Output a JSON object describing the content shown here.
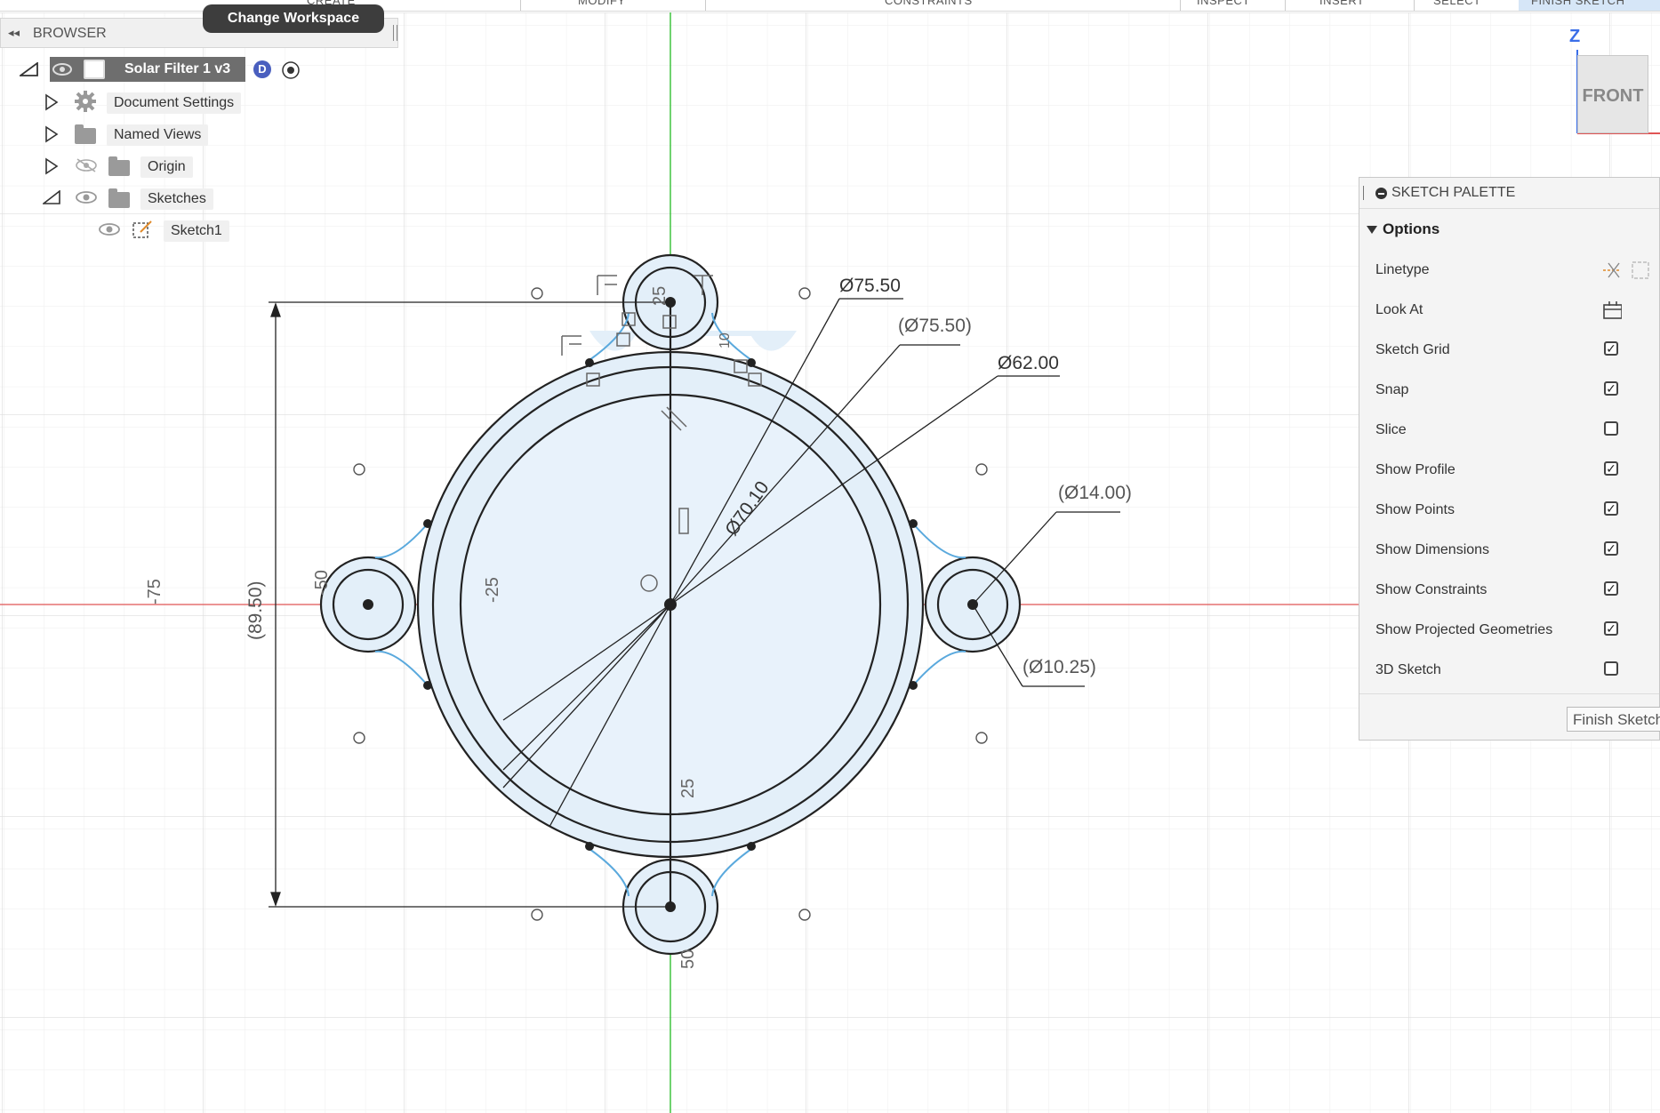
{
  "toolbar": {
    "labels": [
      "CREATE",
      "MODIFY",
      "CONSTRAINTS",
      "INSPECT",
      "INSERT",
      "SELECT",
      "FINISH SKETCH"
    ]
  },
  "tooltip": "Change Workspace",
  "browser": {
    "title": "BROWSER",
    "root": "Solar Filter 1 v3",
    "items": [
      {
        "label": "Document Settings"
      },
      {
        "label": "Named Views"
      },
      {
        "label": "Origin"
      },
      {
        "label": "Sketches"
      },
      {
        "label": "Sketch1"
      }
    ]
  },
  "viewcube": {
    "face": "FRONT",
    "axis": "Z"
  },
  "palette": {
    "title": "SKETCH PALETTE",
    "section": "Options",
    "rows": [
      {
        "label": "Linetype",
        "kind": "icons"
      },
      {
        "label": "Look At",
        "kind": "icon"
      },
      {
        "label": "Sketch Grid",
        "checked": true
      },
      {
        "label": "Snap",
        "checked": true
      },
      {
        "label": "Slice",
        "checked": false
      },
      {
        "label": "Show Profile",
        "checked": true
      },
      {
        "label": "Show Points",
        "checked": true
      },
      {
        "label": "Show Dimensions",
        "checked": true
      },
      {
        "label": "Show Constraints",
        "checked": true
      },
      {
        "label": "Show Projected Geometries",
        "checked": true
      },
      {
        "label": "3D Sketch",
        "checked": false
      }
    ],
    "finish_button": "Finish Sketch"
  },
  "sketch": {
    "dimensions": {
      "d75_50": "Ø75.50",
      "d75_50_ref": "(Ø75.50)",
      "d62_00": "Ø62.00",
      "d70_10": "Ø70.10",
      "d14_00_ref": "(Ø14.00)",
      "d10_25_ref": "(Ø10.25)",
      "h89_50_ref": "(89.50)"
    },
    "axis_labels": {
      "neg75": "-75",
      "neg50": "-50",
      "neg25": "-25",
      "pos25": "25",
      "pos50": "50",
      "top25": "25",
      "top_small": "10"
    }
  },
  "colors": {
    "profile_fill": "#e3eff9",
    "sketch_line": "#222222",
    "x_axis": "#e05555",
    "y_axis": "#22bb22",
    "grid": "#e6e6e6",
    "constraint_blue": "#5aa9dd"
  }
}
